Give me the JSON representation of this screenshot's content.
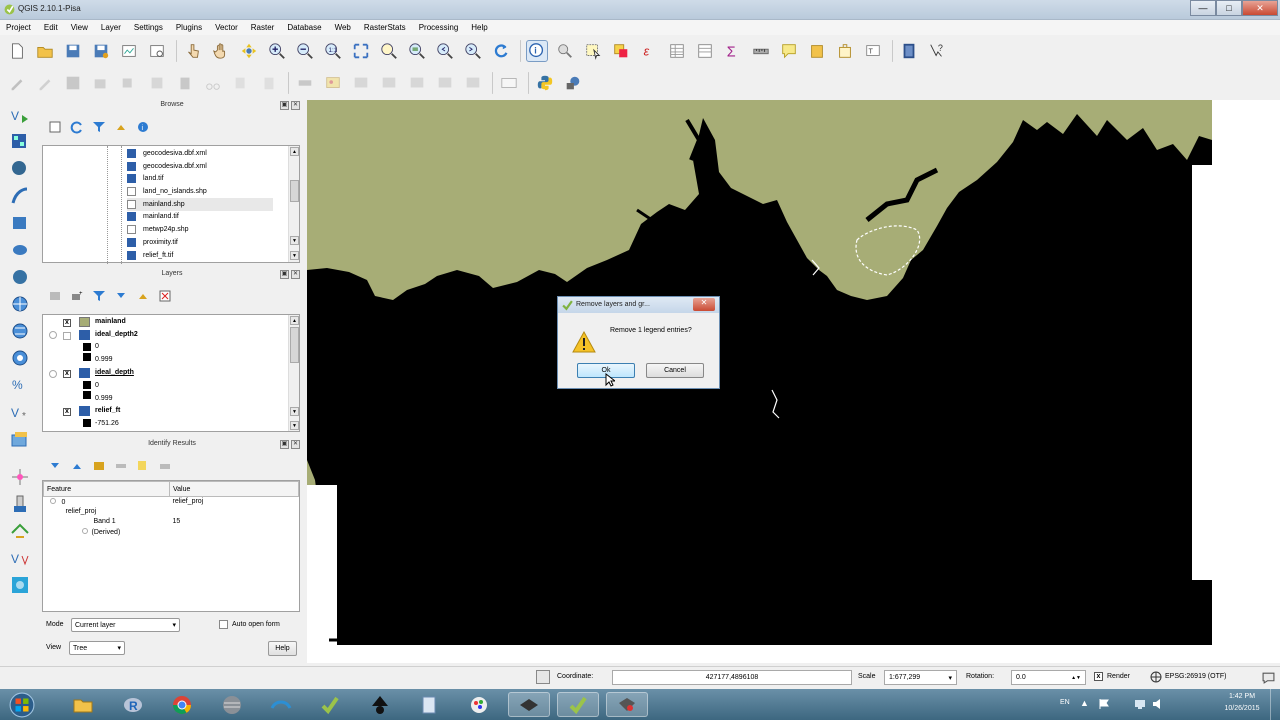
{
  "window": {
    "title": "QGIS 2.10.1-Pisa"
  },
  "menu": [
    "Project",
    "Edit",
    "View",
    "Layer",
    "Settings",
    "Plugins",
    "Vector",
    "Raster",
    "Database",
    "Web",
    "RasterStats",
    "Processing",
    "Help"
  ],
  "browser": {
    "title": "Browse",
    "files": [
      "geocodesiva.dbf.xml",
      "geocodesiva.dbf.xml",
      "land.tif",
      "land_no_islands.shp",
      "mainland.shp",
      "mainland.tif",
      "metwp24p.shp",
      "proximity.tif",
      "relief_ft.tif"
    ]
  },
  "layers": {
    "title": "Layers",
    "items": [
      {
        "name": "mainland"
      },
      {
        "name": "ideal_depth2",
        "v1": "0",
        "v2": "0.999"
      },
      {
        "name": "ideal_depth",
        "v1": "0",
        "v2": "0.999"
      },
      {
        "name": "relief_ft",
        "v1": "-751.26"
      }
    ]
  },
  "identify": {
    "title": "Identify Results",
    "col_feature": "Feature",
    "col_value": "Value",
    "rows": [
      {
        "f": "0",
        "v": "relief_proj"
      },
      {
        "f": "relief_proj",
        "v": ""
      },
      {
        "f": "Band 1",
        "v": "15"
      },
      {
        "f": "(Derived)",
        "v": ""
      }
    ],
    "mode_label": "Mode",
    "mode_value": "Current layer",
    "auto_open": "Auto open form",
    "view_label": "View",
    "view_value": "Tree",
    "help": "Help"
  },
  "dialog": {
    "title": "Remove layers and gr...",
    "message": "Remove 1 legend entries?",
    "ok": "Ok",
    "cancel": "Cancel"
  },
  "status": {
    "coordinate_label": "Coordinate:",
    "coordinate_value": "427177,4896108",
    "scale_label": "Scale",
    "scale_value": "1:677,299",
    "rotation_label": "Rotation:",
    "rotation_value": "0.0",
    "render_label": "Render",
    "crs": "EPSG:26919 (OTF)"
  },
  "tray": {
    "lang": "EN",
    "time": "1:42 PM",
    "date": "10/26/2015"
  },
  "colors": {
    "land": "#a7ad76",
    "water": "#000000",
    "accent": "#3c7fb1"
  }
}
